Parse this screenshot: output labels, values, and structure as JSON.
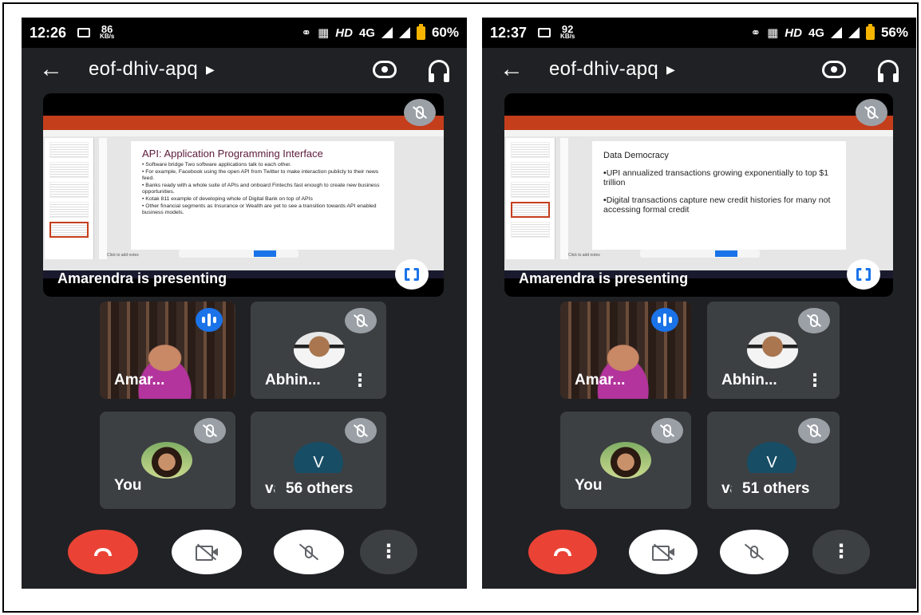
{
  "panels": [
    {
      "status": {
        "time": "12:26",
        "speed_value": "86",
        "speed_unit": "KB/s",
        "network": "HD",
        "net_type": "4G",
        "battery": "60%"
      },
      "meeting": {
        "title": "eof-dhiv-apq"
      },
      "presentation": {
        "presenter_label": "Amarendra is presenting",
        "slide_title": "API: Application Programming Interface",
        "slide_bullets": [
          "Software bridge Two software applications talk to each other.",
          "For example, Facebook using the open API from Twitter to make interaction publicly to their news feed.",
          "Banks ready with a whole suite of APIs and onboard Fintechs fast enough to create new business opportunities.",
          "Kotak 811 example of developing whole of Digital Bank on top of APIs",
          "Other financial segments as Insurance or Wealth are yet to see a transition towards API enabled business models."
        ],
        "notes": "Click to add notes"
      },
      "participants": {
        "presenter_name": "Amar...",
        "second_name": "Abhin...",
        "self_name": "You",
        "letter": "V",
        "partial_name": "vat",
        "others": "56 others"
      }
    },
    {
      "status": {
        "time": "12:37",
        "speed_value": "92",
        "speed_unit": "KB/s",
        "network": "HD",
        "net_type": "4G",
        "battery": "56%"
      },
      "meeting": {
        "title": "eof-dhiv-apq"
      },
      "presentation": {
        "presenter_label": "Amarendra is presenting",
        "slide_title": "Data Democracy",
        "slide_bullets": [
          "UPI annualized transactions growing exponentially to top $1 trillion",
          "Digital transactions capture new credit histories for many not accessing formal credit"
        ],
        "notes": "Click to add notes"
      },
      "participants": {
        "presenter_name": "Amar...",
        "second_name": "Abhin...",
        "self_name": "You",
        "letter": "V",
        "partial_name": "vat",
        "others": "51 others"
      }
    }
  ],
  "icons": {
    "back": "arrow-back-icon",
    "rotate": "camera-rotate-icon",
    "audio": "headset-icon",
    "mic_off": "mic-off-icon",
    "fullscreen": "fullscreen-icon",
    "speaking": "speaking-indicator-icon",
    "more": "more-vert-icon",
    "end_call": "call-end-icon",
    "camera_off": "videocam-off-icon"
  },
  "colors": {
    "background": "#202124",
    "tile": "#3c4043",
    "end_call": "#ea4335",
    "accent": "#1a73e8",
    "ppt_ribbon": "#c43e1c"
  }
}
